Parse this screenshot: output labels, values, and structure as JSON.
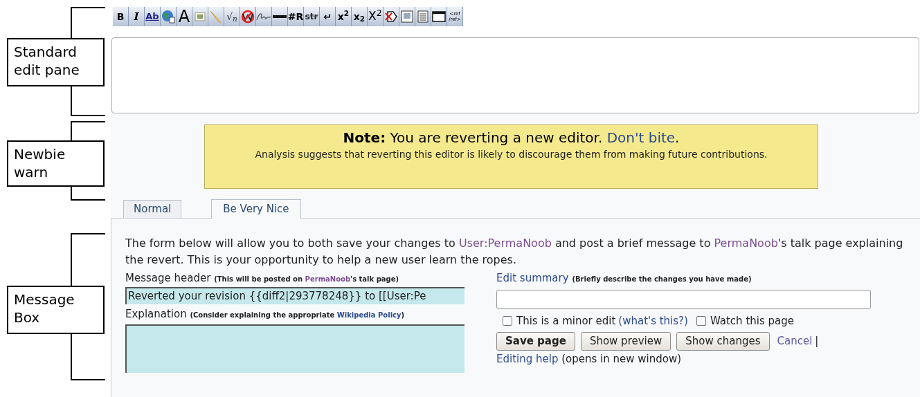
{
  "annotations": [
    {
      "label": "Standard\nedit pane",
      "kind": "edit"
    },
    {
      "label": "Newbie\nwarn",
      "kind": "warn"
    },
    {
      "label": "Message\nBox",
      "kind": "message"
    }
  ],
  "toolbar": [
    {
      "kind": "bold",
      "label": "B"
    },
    {
      "kind": "italic",
      "label": "I"
    },
    {
      "kind": "underline",
      "label": "Ab"
    },
    {
      "kind": "globe"
    },
    {
      "kind": "big",
      "label": "A"
    },
    {
      "kind": "image"
    },
    {
      "kind": "brush"
    },
    {
      "kind": "math",
      "label": "√$_{n}$"
    },
    {
      "kind": "nowiki"
    },
    {
      "kind": "signature"
    },
    {
      "kind": "rule"
    },
    {
      "kind": "bold",
      "label": "#R"
    },
    {
      "kind": "strike",
      "label": "str"
    },
    {
      "kind": "bold",
      "label": "↵"
    },
    {
      "kind": "bold",
      "label": "x$^{2}$"
    },
    {
      "kind": "bold",
      "label": "x$_{2}$"
    },
    {
      "kind": "large",
      "label": "X$^{2}$"
    },
    {
      "kind": "stop"
    },
    {
      "kind": "gallery"
    },
    {
      "kind": "document"
    },
    {
      "kind": "window"
    },
    {
      "kind": "tiny",
      "label": "<ref\n/ref>"
    }
  ],
  "note": {
    "title_bold": "Note:",
    "title": "You are reverting a new editor.",
    "link": "Don't bite",
    "link_end": ".",
    "body": "Analysis suggests that reverting this editor is likely to discourage them from making future contributions."
  },
  "tabs": [
    {
      "label": "Normal",
      "selected": false
    },
    {
      "label": "Be Very Nice",
      "selected": true
    }
  ],
  "intro": [
    {
      "text": "The form below will allow you to both save your changes to "
    },
    {
      "text": "User:PermaNoob",
      "link": true,
      "visited": true
    },
    {
      "text": " and post a brief message to "
    },
    {
      "text": "PermaNoob",
      "link": true,
      "visited": true
    },
    {
      "text": "'s talk page explaining the revert. This is your opportunity to help a new user learn the ropes."
    }
  ],
  "message_header": {
    "label": "Message header",
    "hint": [
      {
        "text": "(This will be posted on "
      },
      {
        "text": "PermaNoob",
        "link": true,
        "visited": true
      },
      {
        "text": "'s talk page)"
      }
    ],
    "value": "Reverted your revision {{diff2|293778248}} to [[User:Pe"
  },
  "explanation": {
    "label": "Explanation",
    "hint": [
      {
        "text": "(Consider explaining the appropriate "
      },
      {
        "text": "Wikipedia Policy",
        "link": true,
        "visited": false
      },
      {
        "text": ")"
      }
    ]
  },
  "edit_summary": {
    "label": "Edit summary",
    "hint": "(Briefly describe the changes you have made)"
  },
  "checkboxes": [
    {
      "label": "This is a minor edit",
      "link": "(what's this?)",
      "checked": false
    },
    {
      "label": "Watch this page",
      "checked": false
    }
  ],
  "buttons": [
    {
      "label": "Save page",
      "primary": true
    },
    {
      "label": "Show preview",
      "primary": false
    },
    {
      "label": "Show changes",
      "primary": false
    }
  ],
  "cancel": "Cancel",
  "separator": "|",
  "help": {
    "link": "Editing help",
    "text": "(opens in new window)"
  }
}
